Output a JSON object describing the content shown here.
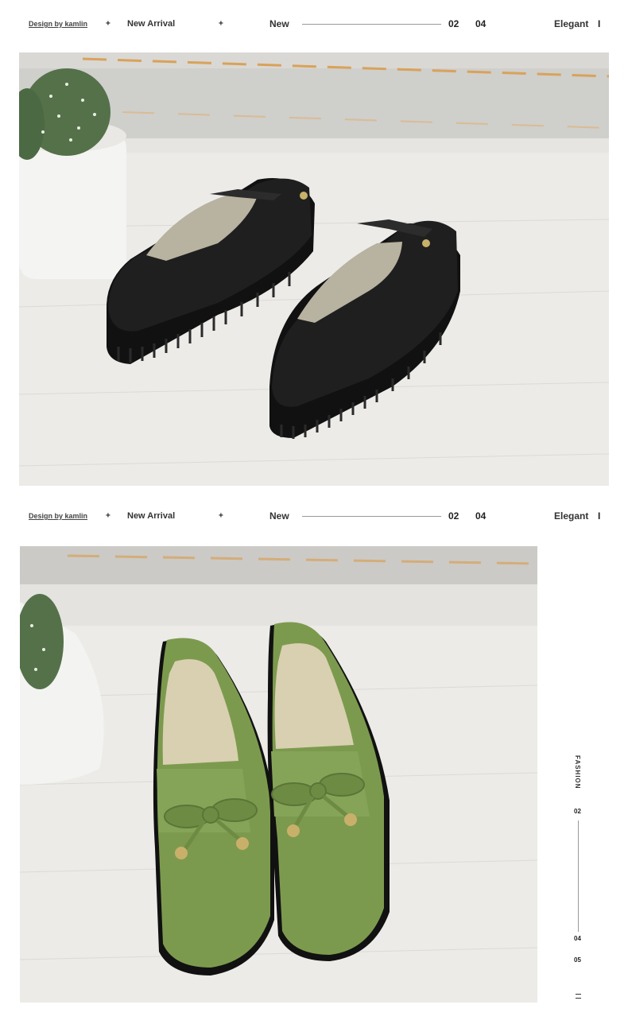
{
  "header": {
    "design_label": "Design by kamlin",
    "plus": "+",
    "new_arrival": "New Arrival",
    "new_label": "New",
    "num_a": "02",
    "num_b": "04",
    "elegant": "Elegant",
    "bar": "I"
  },
  "side": {
    "fashion": "FASHION",
    "n02": "02",
    "n04": "04",
    "n05": "05",
    "menu_icon": "menu-icon"
  },
  "colors": {
    "black_shoe": "#1c1c1c",
    "green_shoe": "#7c9a4e",
    "insole": "#d8d0b0",
    "surface": "#eceae6",
    "wood_trim": "#d9a25a"
  }
}
